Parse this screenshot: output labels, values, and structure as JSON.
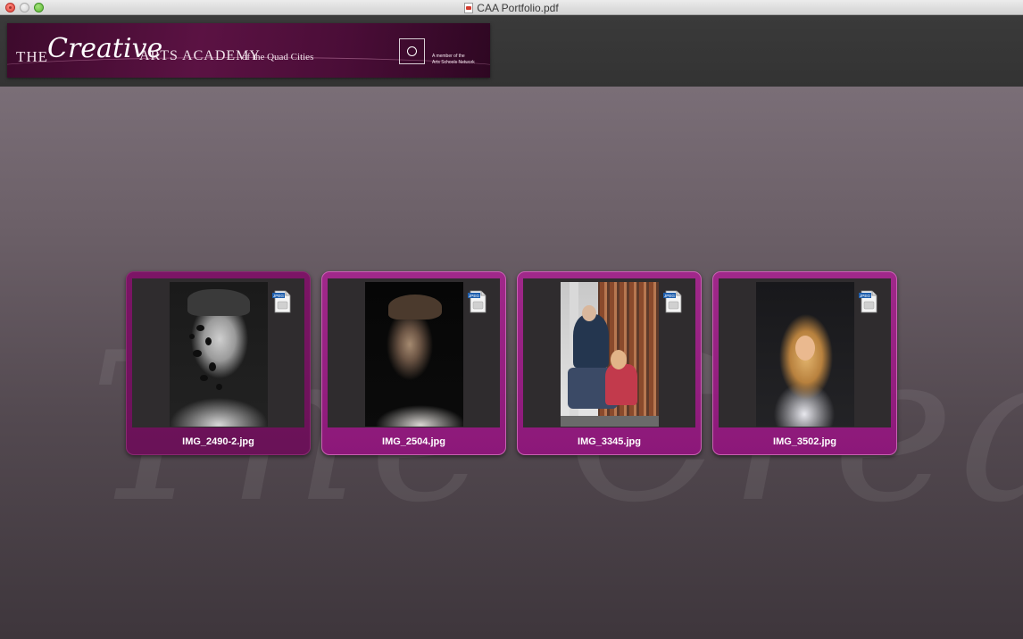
{
  "window": {
    "title": "CAA Portfolio.pdf"
  },
  "banner": {
    "the": "THE",
    "creative": "Creative",
    "arts_academy": "ARTS ACADEMY",
    "of_the_quad_cities": "of the Quad Cities",
    "member_line1": "A member of the",
    "member_line2": "Arts Schools Network"
  },
  "watermark": {
    "text": "The Creative"
  },
  "thumbnails": [
    {
      "label": "IMG_2490-2.jpg",
      "badge": "JPEG",
      "selected": true
    },
    {
      "label": "IMG_2504.jpg",
      "badge": "JPEG",
      "selected": false
    },
    {
      "label": "IMG_3345.jpg",
      "badge": "JPEG",
      "selected": false
    },
    {
      "label": "IMG_3502.jpg",
      "badge": "JPEG",
      "selected": false
    }
  ],
  "colors": {
    "accent": "#8c1879",
    "banner": "#5b1243",
    "titlebar": "#dcdcdc"
  }
}
